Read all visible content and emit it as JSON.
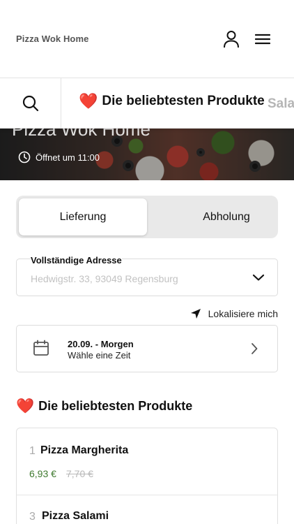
{
  "header": {
    "brand": "Pizza Wok Home",
    "account_icon": "user-icon",
    "menu_icon": "hamburger-menu-icon"
  },
  "categories": {
    "search_icon": "search-icon",
    "active": {
      "icon": "heart",
      "label": "Die beliebtesten Produkte"
    },
    "next": {
      "label": "Salat"
    }
  },
  "hero": {
    "title": "Pizza Wok Home",
    "status": "Öffnet um 11:00"
  },
  "order_mode": {
    "options": [
      "Lieferung",
      "Abholung"
    ],
    "selected": "Lieferung"
  },
  "address": {
    "label": "Vollständige Adresse",
    "placeholder": "Hedwigstr. 33, 93049 Regensburg"
  },
  "locate": {
    "label": "Lokalisiere mich"
  },
  "delivery_time": {
    "date": "20.09. - Morgen",
    "hint": "Wähle eine Zeit"
  },
  "popular": {
    "heading": "Die beliebtesten Produkte",
    "products": [
      {
        "rank": "1",
        "name": "Pizza Margherita",
        "price": "6,93 €",
        "old_price": "7,70 €"
      },
      {
        "rank": "3",
        "name": "Pizza Salami"
      }
    ]
  },
  "colors": {
    "accent_heart": "#d92027",
    "price_green": "#3f7a2f"
  }
}
